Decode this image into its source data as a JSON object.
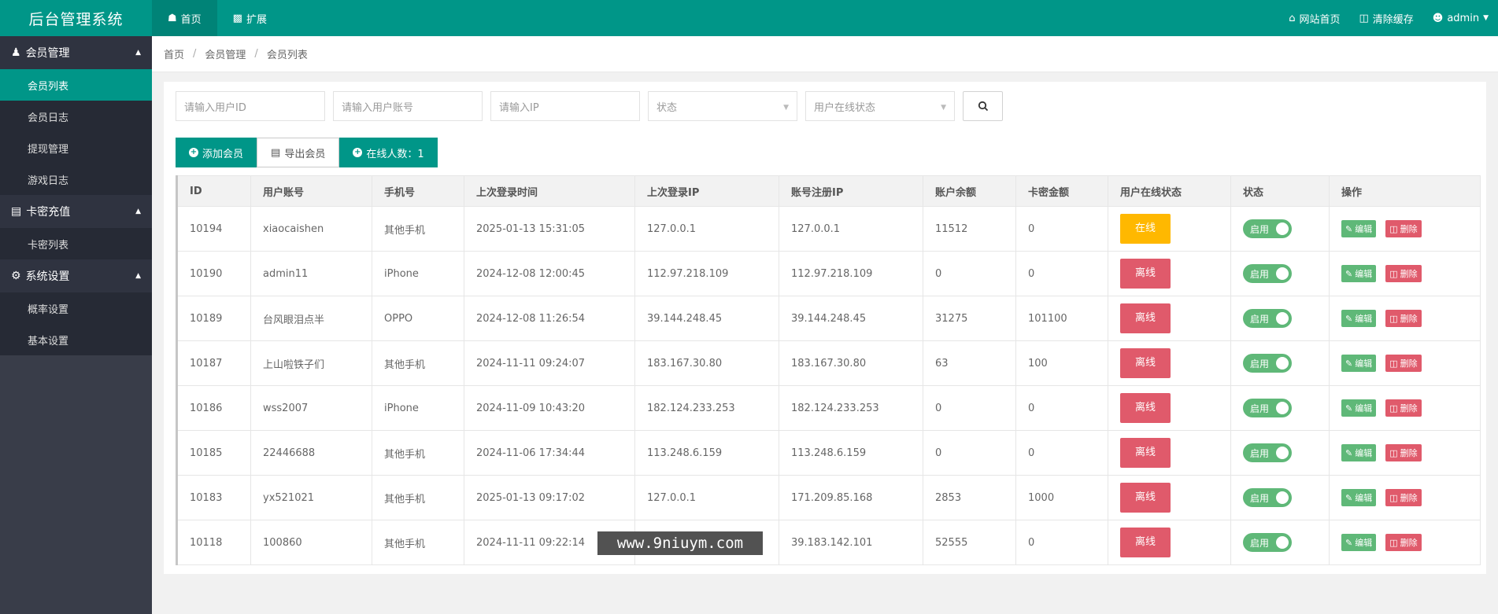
{
  "app": {
    "title": "后台管理系统",
    "top_nav": [
      {
        "label": "首页",
        "icon": "dashboard-icon"
      },
      {
        "label": "扩展",
        "icon": "puzzle-icon"
      }
    ],
    "top_right": [
      {
        "label": "网站首页",
        "icon": "home-icon"
      },
      {
        "label": "清除缓存",
        "icon": "trash-icon"
      },
      {
        "label": "admin",
        "icon": "user-icon"
      }
    ]
  },
  "sidebar": {
    "groups": [
      {
        "title": "会员管理",
        "icon": "users-icon",
        "items": [
          "会员列表",
          "会员日志",
          "提现管理",
          "游戏日志"
        ]
      },
      {
        "title": "卡密充值",
        "icon": "book-icon",
        "items": [
          "卡密列表"
        ]
      },
      {
        "title": "系统设置",
        "icon": "gear-icon",
        "items": [
          "概率设置",
          "基本设置"
        ]
      }
    ]
  },
  "breadcrumb": [
    "首页",
    "会员管理",
    "会员列表"
  ],
  "filters": {
    "user_id_placeholder": "请输入用户ID",
    "account_placeholder": "请输入用户账号",
    "ip_placeholder": "请输入IP",
    "status_select": "状态",
    "online_select": "用户在线状态"
  },
  "actions": {
    "add_member": "添加会员",
    "export_member": "导出会员",
    "online_count": "在线人数：1"
  },
  "table": {
    "columns": [
      "ID",
      "用户账号",
      "手机号",
      "上次登录时间",
      "上次登录IP",
      "账号注册IP",
      "账户余额",
      "卡密金额",
      "用户在线状态",
      "状态",
      "操作"
    ],
    "toggle_label": "启用",
    "edit_label": "编辑",
    "delete_label": "删除",
    "rows": [
      {
        "id": "10194",
        "account": "xiaocaishen",
        "phone": "其他手机",
        "last_login": "2025-01-13 15:31:05",
        "last_ip": "127.0.0.1",
        "reg_ip": "127.0.0.1",
        "balance": "11512",
        "card": "0",
        "online": "在线"
      },
      {
        "id": "10190",
        "account": "admin11",
        "phone": "iPhone",
        "last_login": "2024-12-08 12:00:45",
        "last_ip": "112.97.218.109",
        "reg_ip": "112.97.218.109",
        "balance": "0",
        "card": "0",
        "online": "离线"
      },
      {
        "id": "10189",
        "account": "台风眼泪点半",
        "phone": "OPPO",
        "last_login": "2024-12-08 11:26:54",
        "last_ip": "39.144.248.45",
        "reg_ip": "39.144.248.45",
        "balance": "31275",
        "card": "101100",
        "online": "离线"
      },
      {
        "id": "10187",
        "account": "上山啦铁子们",
        "phone": "其他手机",
        "last_login": "2024-11-11 09:24:07",
        "last_ip": "183.167.30.80",
        "reg_ip": "183.167.30.80",
        "balance": "63",
        "card": "100",
        "online": "离线"
      },
      {
        "id": "10186",
        "account": "wss2007",
        "phone": "iPhone",
        "last_login": "2024-11-09 10:43:20",
        "last_ip": "182.124.233.253",
        "reg_ip": "182.124.233.253",
        "balance": "0",
        "card": "0",
        "online": "离线"
      },
      {
        "id": "10185",
        "account": "22446688",
        "phone": "其他手机",
        "last_login": "2024-11-06 17:34:44",
        "last_ip": "113.248.6.159",
        "reg_ip": "113.248.6.159",
        "balance": "0",
        "card": "0",
        "online": "离线"
      },
      {
        "id": "10183",
        "account": "yx521021",
        "phone": "其他手机",
        "last_login": "2025-01-13 09:17:02",
        "last_ip": "127.0.0.1",
        "reg_ip": "171.209.85.168",
        "balance": "2853",
        "card": "1000",
        "online": "离线"
      },
      {
        "id": "10118",
        "account": "100860",
        "phone": "其他手机",
        "last_login": "2024-11-11 09:22:14",
        "last_ip": "",
        "reg_ip": "39.183.142.101",
        "balance": "52555",
        "card": "0",
        "online": "离线"
      }
    ]
  },
  "watermark": "www.9niuym.com",
  "colors": {
    "primary": "#009688",
    "online": "#ffb800",
    "offline": "#e05a6b",
    "enable": "#5fb878",
    "sidebar": "#393d49"
  }
}
